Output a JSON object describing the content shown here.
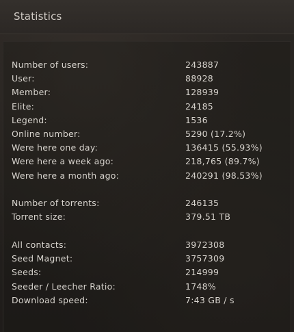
{
  "header": {
    "title": "Statistics"
  },
  "groups": [
    {
      "rows": [
        {
          "label": "Number of users:",
          "value": "243887"
        },
        {
          "label": "User:",
          "value": "88928"
        },
        {
          "label": "Member:",
          "value": "128939"
        },
        {
          "label": "Elite:",
          "value": "24185"
        },
        {
          "label": "Legend:",
          "value": "1536"
        },
        {
          "label": "Online number:",
          "value": "5290 (17.2%)"
        },
        {
          "label": "Were here one day:",
          "value": "136415 (55.93%)"
        },
        {
          "label": "Were here a week ago:",
          "value": "218,765 (89.7%)"
        },
        {
          "label": "Were here a month ago:",
          "value": "240291 (98.53%)"
        }
      ]
    },
    {
      "rows": [
        {
          "label": "Number of torrents:",
          "value": "246135"
        },
        {
          "label": "Torrent size:",
          "value": "379.51 TB"
        }
      ]
    },
    {
      "rows": [
        {
          "label": "All contacts:",
          "value": "3972308"
        },
        {
          "label": "Seed Magnet:",
          "value": "3757309"
        },
        {
          "label": "Seeds:",
          "value": "214999"
        },
        {
          "label": "Seeder / Leecher Ratio:",
          "value": "1748%"
        },
        {
          "label": "Download speed:",
          "value": "7:43 GB / s"
        }
      ]
    }
  ]
}
